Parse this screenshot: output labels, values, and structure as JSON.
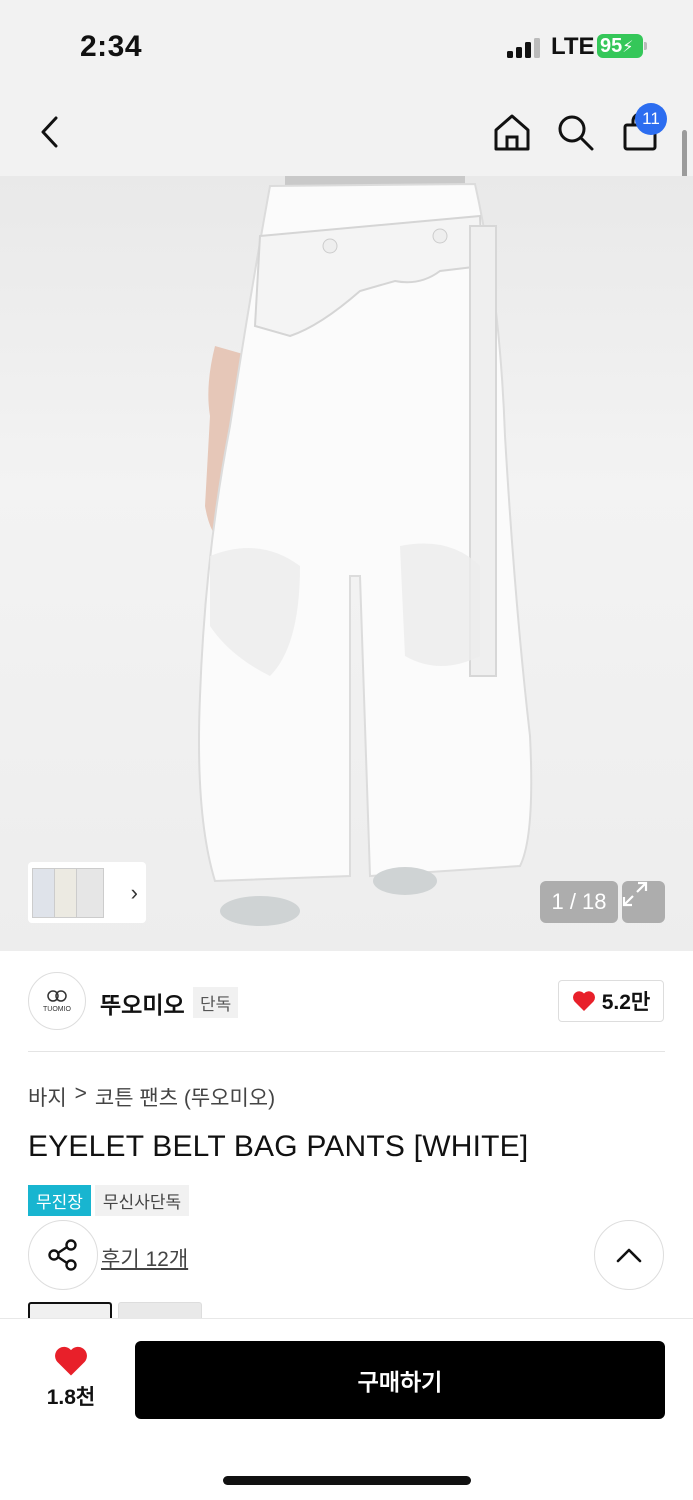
{
  "status_bar": {
    "time": "2:34",
    "network": "LTE",
    "battery": "95"
  },
  "nav": {
    "cart_count": "11",
    "icons": [
      "chevron-left-icon",
      "home-icon",
      "search-icon",
      "shopping-bag-icon"
    ]
  },
  "gallery": {
    "counter": "1 / 18",
    "thumb_arrow": "›"
  },
  "brand": {
    "logo_text": "TUOMIO",
    "name": "뚜오미오",
    "exclusive_label": "단독",
    "likes": "5.2만"
  },
  "breadcrumb": {
    "category": "바지",
    "separator": ">",
    "subcategory": "코튼 팬츠 (뚜오미오)"
  },
  "product": {
    "title": "EYELET BELT BAG PANTS [WHITE]"
  },
  "tags": [
    "무진장",
    "무신사단독"
  ],
  "review": {
    "label": "후기 12개"
  },
  "bottom": {
    "wish_count": "1.8천",
    "buy_label": "구매하기"
  },
  "colors": {
    "heart": "#e8202a",
    "badge": "#2c6df0",
    "tag_accent": "#18b5d0",
    "battery": "#35c759"
  }
}
